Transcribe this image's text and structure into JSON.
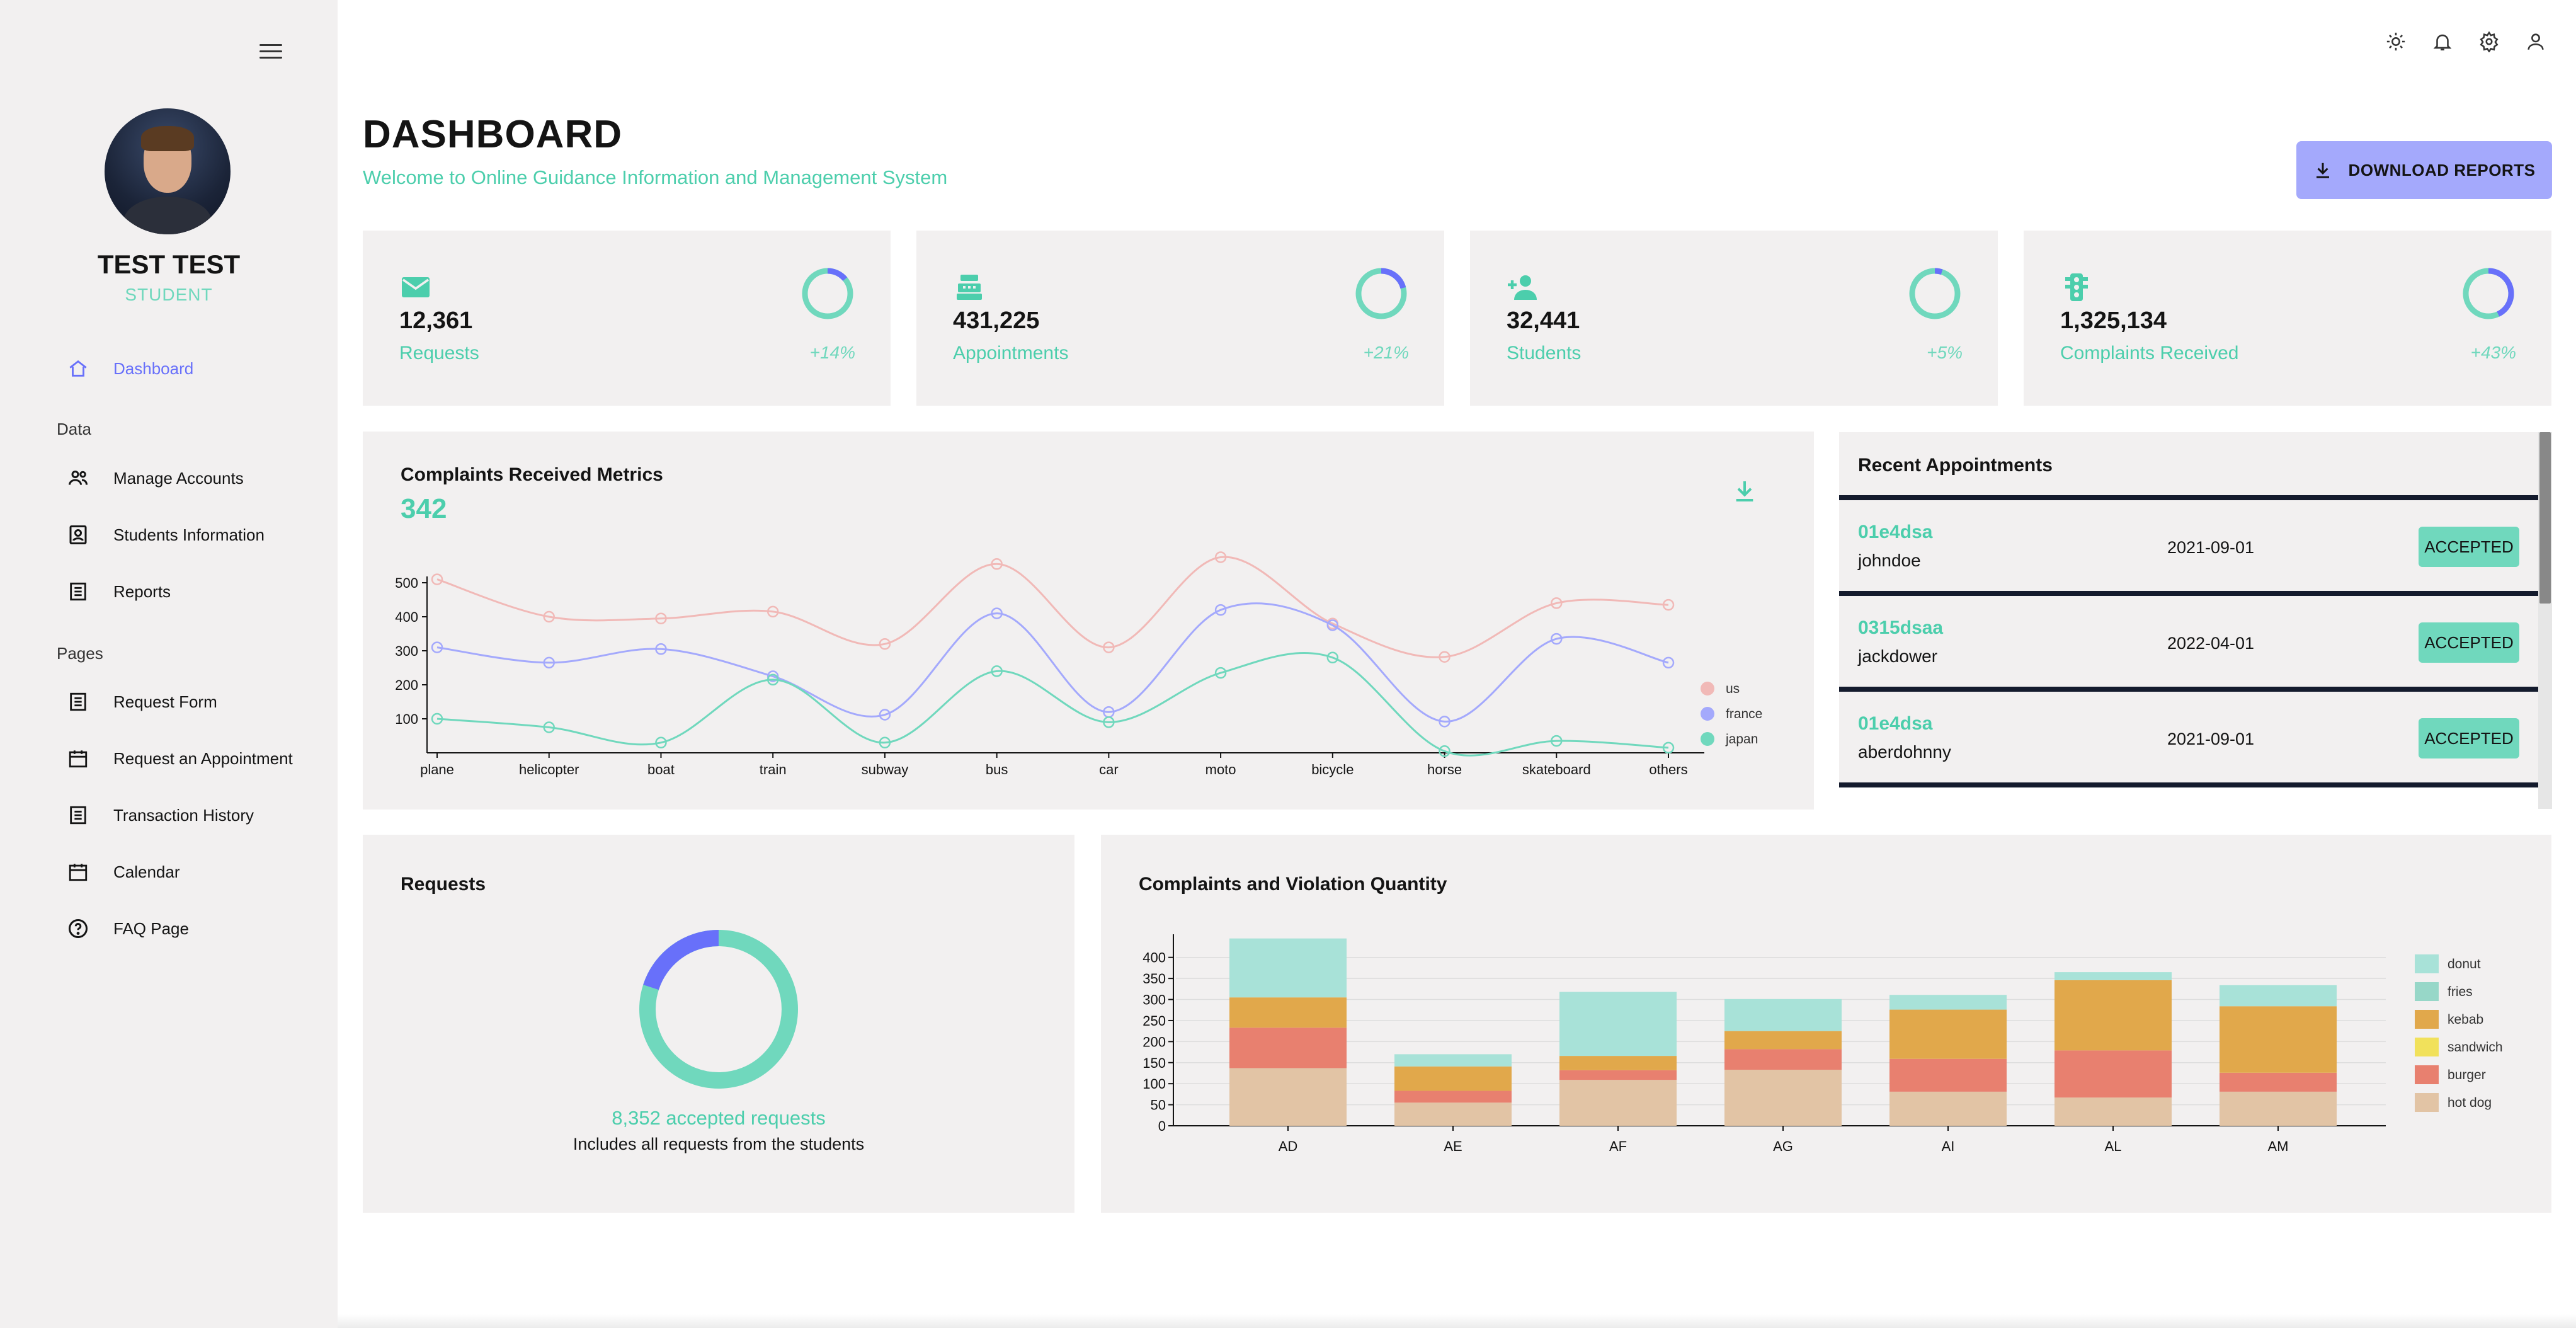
{
  "sidebar": {
    "name": "TEST TEST",
    "role": "STUDENT",
    "dashboard_label": "Dashboard",
    "section_data": "Data",
    "section_pages": "Pages",
    "items": [
      {
        "label": "Manage Accounts"
      },
      {
        "label": "Students Information"
      },
      {
        "label": "Reports"
      },
      {
        "label": "Request Form"
      },
      {
        "label": "Request an Appointment"
      },
      {
        "label": "Transaction History"
      },
      {
        "label": "Calendar"
      },
      {
        "label": "FAQ Page"
      }
    ]
  },
  "topbar": {
    "icons": [
      "sun-icon",
      "bell-icon",
      "gear-icon",
      "user-icon"
    ]
  },
  "header": {
    "title": "DASHBOARD",
    "subtitle": "Welcome to Online Guidance Information and Management System",
    "download_label": "DOWNLOAD REPORTS"
  },
  "stats": [
    {
      "value": "12,361",
      "label": "Requests",
      "change": "+14%",
      "progress": 0.14,
      "icon": "email-icon"
    },
    {
      "value": "431,225",
      "label": "Appointments",
      "change": "+21%",
      "progress": 0.21,
      "icon": "register-icon"
    },
    {
      "value": "32,441",
      "label": "Students",
      "change": "+5%",
      "progress": 0.05,
      "icon": "person-add-icon"
    },
    {
      "value": "1,325,134",
      "label": "Complaints Received",
      "change": "+43%",
      "progress": 0.43,
      "icon": "traffic-icon"
    }
  ],
  "colors": {
    "accent_green": "#4cceac",
    "light_green": "#70d8bd",
    "accent_blue": "#6870fa",
    "button_blue": "#a4a9fc",
    "card_bg": "#f2f0f0",
    "series_us": "#f1b9b7",
    "series_france": "#a4a9fc",
    "series_japan": "#70d8bd"
  },
  "line_panel": {
    "title": "Complaints Received Metrics",
    "value": "342"
  },
  "appointments": {
    "title": "Recent Appointments",
    "rows": [
      {
        "id": "01e4dsa",
        "user": "johndoe",
        "date": "2021-09-01",
        "status": "ACCEPTED"
      },
      {
        "id": "0315dsaa",
        "user": "jackdower",
        "date": "2022-04-01",
        "status": "ACCEPTED"
      },
      {
        "id": "01e4dsa",
        "user": "aberdohnny",
        "date": "2021-09-01",
        "status": "ACCEPTED"
      }
    ]
  },
  "requests_panel": {
    "title": "Requests",
    "accepted_text": "8,352 accepted requests",
    "note": "Includes all requests from the students",
    "progress": 0.2
  },
  "bar_panel": {
    "title": "Complaints and Violation Quantity"
  },
  "chart_data": [
    {
      "type": "line",
      "title": "",
      "x": [
        "plane",
        "helicopter",
        "boat",
        "train",
        "subway",
        "bus",
        "car",
        "moto",
        "bicycle",
        "horse",
        "skateboard",
        "others"
      ],
      "yticks": [
        100,
        200,
        300,
        400,
        500
      ],
      "ylim": [
        0,
        500
      ],
      "legend_position": "right",
      "series": [
        {
          "name": "us",
          "color": "#f1b9b7",
          "values": [
            510,
            400,
            395,
            415,
            320,
            555,
            310,
            575,
            380,
            282,
            440,
            435
          ]
        },
        {
          "name": "france",
          "color": "#a4a9fc",
          "values": [
            310,
            265,
            305,
            225,
            112,
            410,
            120,
            420,
            375,
            92,
            335,
            265
          ]
        },
        {
          "name": "japan",
          "color": "#70d8bd",
          "values": [
            100,
            75,
            30,
            215,
            30,
            240,
            90,
            235,
            280,
            5,
            35,
            15
          ]
        }
      ]
    },
    {
      "type": "pie",
      "title": "",
      "values": [
        20,
        80
      ],
      "colors": [
        "#6870fa",
        "#70d8bd"
      ]
    },
    {
      "type": "bar",
      "stacked": true,
      "title": "",
      "categories": [
        "AD",
        "AE",
        "AF",
        "AG",
        "AI",
        "AL",
        "AM"
      ],
      "yticks": [
        0,
        50,
        100,
        150,
        200,
        250,
        300,
        350,
        400
      ],
      "ylim": [
        0,
        440
      ],
      "legend_position": "right",
      "series": [
        {
          "name": "hot dog",
          "color": "#e2c4a5",
          "values": [
            137,
            55,
            109,
            133,
            81,
            67,
            81
          ]
        },
        {
          "name": "burger",
          "color": "#e8806f",
          "values": [
            96,
            28,
            23,
            49,
            78,
            112,
            45
          ]
        },
        {
          "name": "sandwich",
          "color": "#f1e15b",
          "values": [
            0,
            0,
            0,
            0,
            0,
            0,
            0
          ]
        },
        {
          "name": "kebab",
          "color": "#e1a84b",
          "values": [
            72,
            58,
            34,
            43,
            117,
            167,
            158
          ]
        },
        {
          "name": "fries",
          "color": "#97d7c8",
          "values": [
            0,
            0,
            0,
            0,
            0,
            0,
            0
          ]
        },
        {
          "name": "donut",
          "color": "#a8e2d8",
          "values": [
            140,
            29,
            152,
            76,
            35,
            19,
            50
          ]
        }
      ],
      "legend": [
        "donut",
        "fries",
        "kebab",
        "sandwich",
        "burger",
        "hot dog"
      ],
      "legend_colors": [
        "#a8e2d8",
        "#97d7c8",
        "#e1a84b",
        "#f1e15b",
        "#e8806f",
        "#e2c4a5"
      ]
    }
  ]
}
